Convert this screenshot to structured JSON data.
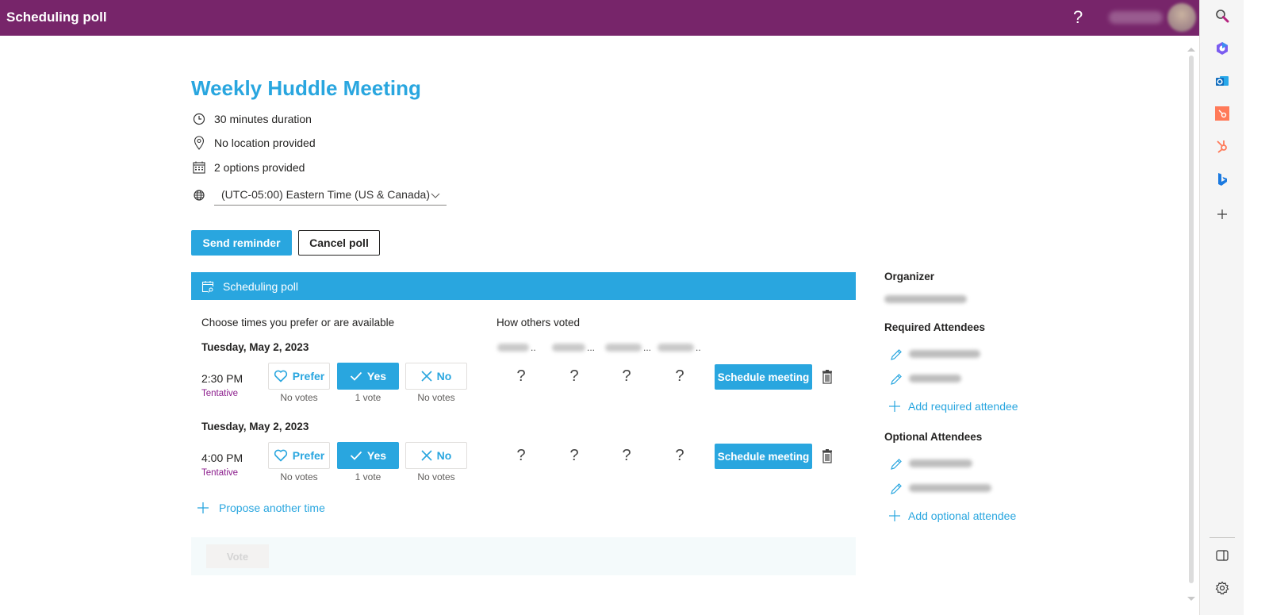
{
  "header": {
    "title": "Scheduling poll",
    "help_label": "?",
    "user_name_blurred": "User Name"
  },
  "rail": {
    "icons": [
      "search-icon",
      "copilot-icon",
      "outlook-icon",
      "hubspot-square-icon",
      "hubspot-icon",
      "bing-icon",
      "add-icon"
    ],
    "bottom_icons": [
      "side-panel-icon",
      "settings-icon"
    ]
  },
  "meeting": {
    "title": "Weekly Huddle Meeting",
    "duration": "30 minutes duration",
    "location": "No location provided",
    "options": "2 options provided",
    "timezone": "(UTC-05:00) Eastern Time (US & Canada)"
  },
  "actions": {
    "send_reminder": "Send reminder",
    "cancel_poll": "Cancel poll"
  },
  "poll": {
    "header": "Scheduling poll",
    "choose_label": "Choose times you prefer or are available",
    "others_label": "How others voted",
    "voters": [
      "Eman ..",
      "Hira Sr...",
      "Ayesha ...",
      "Khadija .."
    ],
    "prefer_label": "Prefer",
    "yes_label": "Yes",
    "no_label": "No",
    "schedule_label": "Schedule meeting",
    "unknown_vote": "?",
    "options": [
      {
        "date": "Tuesday, May 2, 2023",
        "time": "2:30 PM",
        "status": "Tentative",
        "prefer_count": "No votes",
        "yes_count": "1 vote",
        "no_count": "No votes",
        "selected": "yes",
        "others": [
          "?",
          "?",
          "?",
          "?"
        ]
      },
      {
        "date": "Tuesday, May 2, 2023",
        "time": "4:00 PM",
        "status": "Tentative",
        "prefer_count": "No votes",
        "yes_count": "1 vote",
        "no_count": "No votes",
        "selected": "yes",
        "others": [
          "?",
          "?",
          "?",
          "?"
        ]
      }
    ],
    "propose_label": "Propose another time",
    "vote_label": "Vote"
  },
  "attendees": {
    "organizer_label": "Organizer",
    "organizer_name": "User Name",
    "required_label": "Required Attendees",
    "required": [
      "Attendee One",
      "Attendee Two"
    ],
    "add_required_label": "Add required attendee",
    "optional_label": "Optional Attendees",
    "optional": [
      "Attendee Three",
      "Attendee Four"
    ],
    "add_optional_label": "Add optional attendee"
  },
  "colors": {
    "brand": "#77256a",
    "accent": "#29a6df",
    "tentative": "#8b1c8c"
  }
}
